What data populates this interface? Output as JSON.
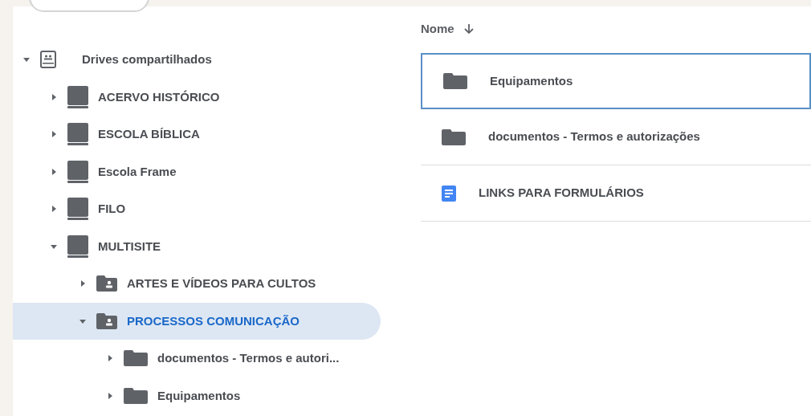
{
  "tree": [
    {
      "label": "Drives compartilhados",
      "kind": "root",
      "expanded": true,
      "selected": false,
      "children": [
        {
          "label": "ACERVO HISTÓRICO",
          "kind": "drive",
          "expanded": false,
          "selected": false
        },
        {
          "label": "ESCOLA BÍBLICA",
          "kind": "drive",
          "expanded": false,
          "selected": false
        },
        {
          "label": "Escola Frame",
          "kind": "drive",
          "expanded": false,
          "selected": false
        },
        {
          "label": "FILO",
          "kind": "drive",
          "expanded": false,
          "selected": false
        },
        {
          "label": "MULTISITE",
          "kind": "drive",
          "expanded": true,
          "selected": false,
          "children": [
            {
              "label": "ARTES E VÍDEOS PARA CULTOS",
              "kind": "shared-folder",
              "expanded": false,
              "selected": false
            },
            {
              "label": "PROCESSOS COMUNICAÇÃO",
              "kind": "shared-folder",
              "expanded": true,
              "selected": true,
              "children": [
                {
                  "label": "documentos - Termos e autori...",
                  "kind": "folder",
                  "expanded": false,
                  "selected": false
                },
                {
                  "label": "Equipamentos",
                  "kind": "folder",
                  "expanded": false,
                  "selected": false
                }
              ]
            }
          ]
        }
      ]
    }
  ],
  "list": {
    "column": "Nome",
    "rows": [
      {
        "name": "Equipamentos",
        "kind": "folder",
        "selected": true
      },
      {
        "name": "documentos - Termos e autorizações",
        "kind": "folder",
        "selected": false
      },
      {
        "name": "LINKS PARA FORMULÁRIOS",
        "kind": "doc",
        "selected": false
      }
    ]
  }
}
